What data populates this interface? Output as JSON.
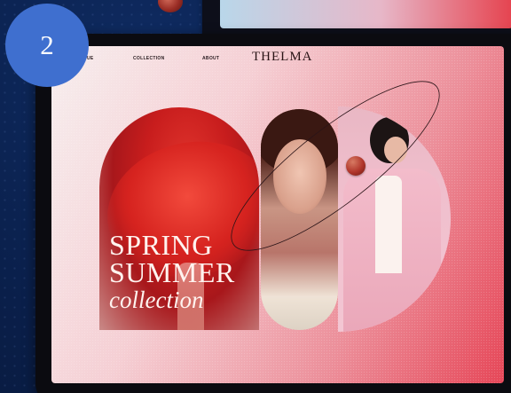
{
  "badge": {
    "number": "2"
  },
  "site": {
    "brand": "THELMA",
    "nav": [
      {
        "label": "UE"
      },
      {
        "label": "COLLECTION"
      },
      {
        "label": "ABOUT"
      }
    ]
  },
  "hero": {
    "line1": "SPRING",
    "line2": "SUMMER",
    "line3": "collection"
  },
  "colors": {
    "badge": "#3f6fcf",
    "background": "#0a1f4a",
    "accent_red": "#e64758"
  }
}
